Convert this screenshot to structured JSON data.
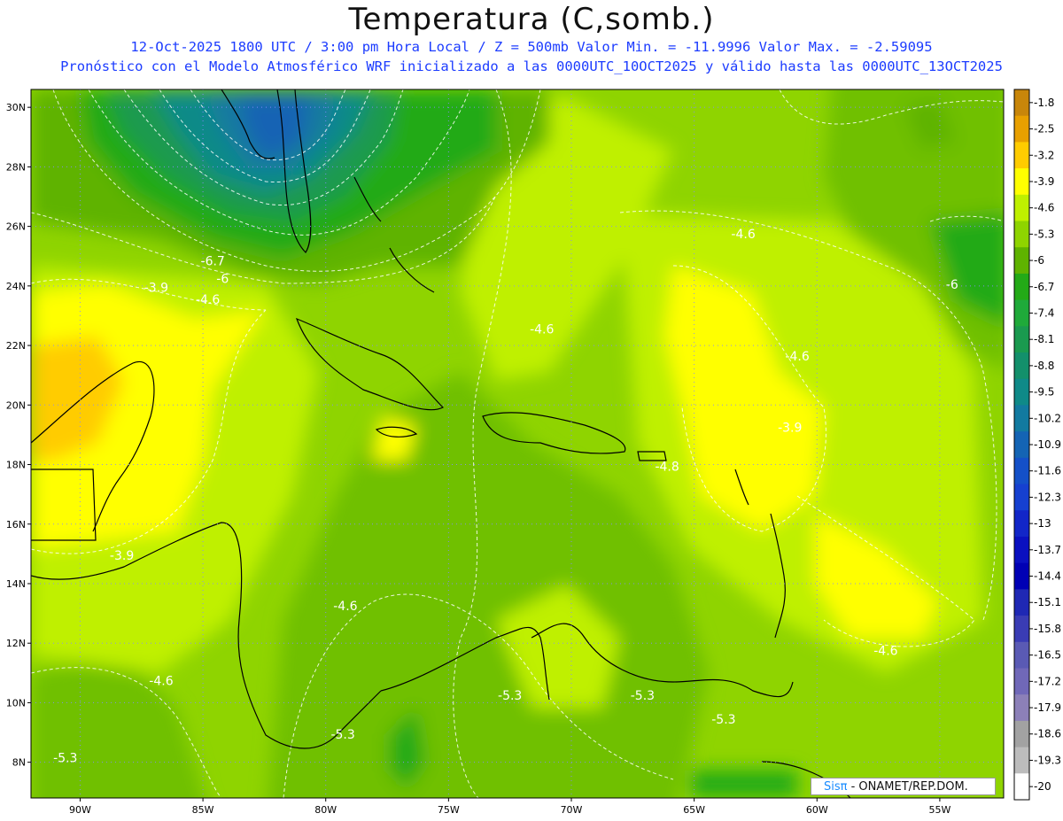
{
  "header": {
    "title": "Temperatura (C,somb.)",
    "subtitle_line1": "12-Oct-2025  1800 UTC / 3:00 pm Hora Local / Z = 500mb  Valor Min. = -11.9996  Valor Max. = -2.59095",
    "subtitle_line2": "Pronóstico con el Modelo Atmosférico WRF inicializado a las 0000UTC_10OCT2025 y válido hasta las  0000UTC_13OCT2025"
  },
  "map": {
    "lon_range": [
      -92,
      -52.4
    ],
    "lat_range": [
      6.8,
      30.6
    ],
    "lat_ticks": [
      "30N",
      "28N",
      "26N",
      "24N",
      "22N",
      "20N",
      "18N",
      "16N",
      "14N",
      "12N",
      "10N",
      "8N"
    ],
    "lat_values": [
      30,
      28,
      26,
      24,
      22,
      20,
      18,
      16,
      14,
      12,
      10,
      8
    ],
    "lon_ticks": [
      "90W",
      "85W",
      "80W",
      "75W",
      "70W",
      "65W",
      "60W",
      "55W"
    ],
    "lon_values": [
      -90,
      -85,
      -80,
      -75,
      -70,
      -65,
      -60,
      -55
    ],
    "grid": true,
    "contour_labels": [
      {
        "text": "-6.7",
        "lon": -84.6,
        "lat": 24.7
      },
      {
        "text": "-6",
        "lon": -84.2,
        "lat": 24.1
      },
      {
        "text": "-3.9",
        "lon": -86.9,
        "lat": 23.8
      },
      {
        "text": "-4.6",
        "lon": -84.8,
        "lat": 23.4
      },
      {
        "text": "-4.6",
        "lon": -63.0,
        "lat": 25.6
      },
      {
        "text": "-4.6",
        "lon": -71.2,
        "lat": 22.4
      },
      {
        "text": "-6",
        "lon": -54.5,
        "lat": 23.9
      },
      {
        "text": "-4.6",
        "lon": -60.8,
        "lat": 21.5
      },
      {
        "text": "-3.9",
        "lon": -61.1,
        "lat": 19.1
      },
      {
        "text": "-4.8",
        "lon": -66.1,
        "lat": 17.8
      },
      {
        "text": "-3.9",
        "lon": -88.3,
        "lat": 14.8
      },
      {
        "text": "-4.6",
        "lon": -79.2,
        "lat": 13.1
      },
      {
        "text": "-4.6",
        "lon": -57.2,
        "lat": 11.6
      },
      {
        "text": "-4.6",
        "lon": -86.7,
        "lat": 10.6
      },
      {
        "text": "-5.3",
        "lon": -72.5,
        "lat": 10.1
      },
      {
        "text": "-5.3",
        "lon": -67.1,
        "lat": 10.1
      },
      {
        "text": "-5.3",
        "lon": -63.8,
        "lat": 9.3
      },
      {
        "text": "-5.3",
        "lon": -79.3,
        "lat": 8.8
      },
      {
        "text": "-5.3",
        "lon": -90.6,
        "lat": 8.0
      }
    ]
  },
  "colorbar": {
    "labels": [
      "-1.8",
      "-2.5",
      "-3.2",
      "-3.9",
      "-4.6",
      "-5.3",
      "-6",
      "-6.7",
      "-7.4",
      "-8.1",
      "-8.8",
      "-9.5",
      "-10.2",
      "-10.9",
      "-11.6",
      "-12.3",
      "-13",
      "-13.7",
      "-14.4",
      "-15.1",
      "-15.8",
      "-16.5",
      "-17.2",
      "-17.9",
      "-18.6",
      "-19.3",
      "-20"
    ],
    "colors": [
      "#c8860a",
      "#e8a000",
      "#ffcc00",
      "#ffff00",
      "#bff000",
      "#8fd400",
      "#5fb300",
      "#23aa17",
      "#1faa3a",
      "#1a9a4f",
      "#13906b",
      "#0f8a88",
      "#127aa0",
      "#1464b4",
      "#1450c8",
      "#1640d0",
      "#1226c8",
      "#0a10c0",
      "#0000b4",
      "#1f28b4",
      "#3a3cb4",
      "#5a5ab4",
      "#7068b8",
      "#8c80b8",
      "#a2a2a2",
      "#bcbcbc",
      "#ffffff"
    ]
  },
  "credit": {
    "brand": "Sisπ",
    "text": " - ONAMET/REP.DOM."
  }
}
